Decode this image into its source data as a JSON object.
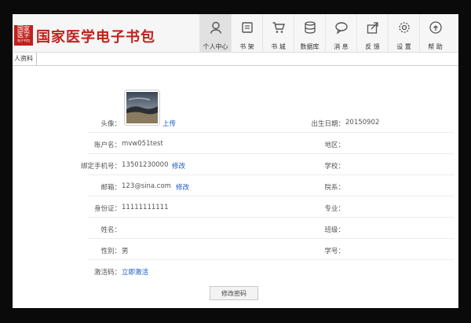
{
  "header": {
    "logo_text_line1": "国家",
    "logo_text_line2": "医学",
    "logo_text_line3": "电子书包",
    "brand": "国家医学电子书包"
  },
  "nav": [
    {
      "label": "个人中心",
      "icon": "person-icon",
      "active": true
    },
    {
      "label": "书 架",
      "icon": "bookshelf-icon",
      "active": false
    },
    {
      "label": "书 城",
      "icon": "cart-icon",
      "active": false
    },
    {
      "label": "数据库",
      "icon": "database-icon",
      "active": false
    },
    {
      "label": "消 息",
      "icon": "message-icon",
      "active": false
    },
    {
      "label": "反 馈",
      "icon": "share-icon",
      "active": false
    },
    {
      "label": "设 置",
      "icon": "gear-icon",
      "active": false
    },
    {
      "label": "帮 助",
      "icon": "help-icon",
      "active": false
    }
  ],
  "tab": {
    "label": "人资料"
  },
  "profile": {
    "avatar_label": "头像：",
    "upload": "上传",
    "account_label": "账户名：",
    "account_value": "mvw051test",
    "phone_label": "绑定手机号：",
    "phone_value": "13501230000",
    "phone_edit": "修改",
    "email_label": "邮箱：",
    "email_value": "123@sina.com",
    "email_edit": "修改",
    "id_label": "身份证：",
    "id_value": "11111111111",
    "name_label": "姓名：",
    "name_value": "",
    "gender_label": "性别：",
    "gender_value": "男",
    "activation_label": "激活码：",
    "activation_link": "立即激活",
    "birth_label": "出生日期：",
    "birth_value": "20150902",
    "region_label": "地区：",
    "school_label": "学校：",
    "department_label": "院系：",
    "major_label": "专业：",
    "class_label": "班级：",
    "student_no_label": "学号："
  },
  "buttons": {
    "change_password": "修改密码"
  },
  "colors": {
    "brand_red": "#c0211c",
    "link_blue": "#1a57c4"
  }
}
